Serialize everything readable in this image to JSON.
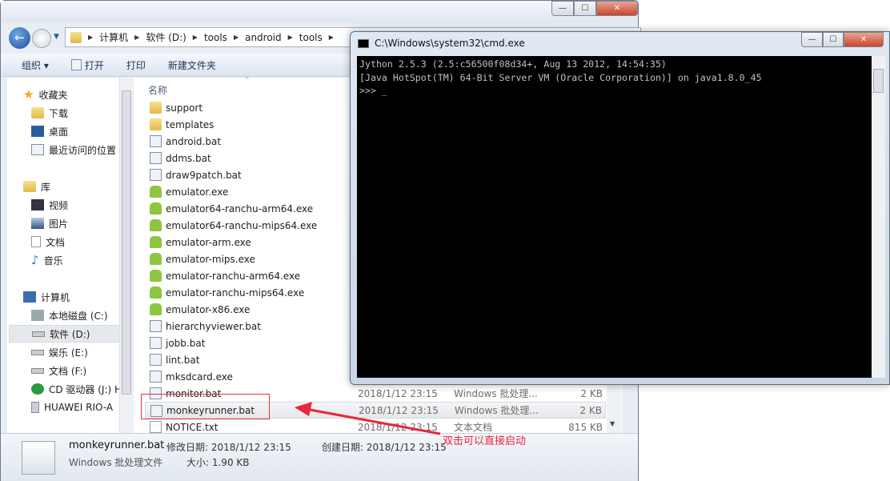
{
  "explorer": {
    "window_controls": {
      "minimize": "—",
      "maximize": "☐",
      "close": "✕"
    },
    "breadcrumb": [
      "计算机",
      "软件 (D:)",
      "tools",
      "android",
      "tools"
    ],
    "toolbar": {
      "organize": "组织 ▾",
      "open": "打开",
      "print": "打印",
      "new_folder": "新建文件夹"
    },
    "nav": {
      "favorites": {
        "label": "收藏夹",
        "items": [
          "下载",
          "桌面",
          "最近访问的位置"
        ]
      },
      "libraries": {
        "label": "库",
        "items": [
          "视频",
          "图片",
          "文档",
          "音乐"
        ]
      },
      "computer": {
        "label": "计算机",
        "items": [
          "本地磁盘 (C:)",
          "软件 (D:)",
          "娱乐 (E:)",
          "文档 (F:)",
          "CD 驱动器 (J:) H",
          "HUAWEI RIO-A"
        ]
      },
      "selected": "软件 (D:)"
    },
    "columns": {
      "name": "名称"
    },
    "files": [
      {
        "name": "support",
        "kind": "folder"
      },
      {
        "name": "templates",
        "kind": "folder"
      },
      {
        "name": "android.bat",
        "kind": "bat"
      },
      {
        "name": "ddms.bat",
        "kind": "bat"
      },
      {
        "name": "draw9patch.bat",
        "kind": "bat"
      },
      {
        "name": "emulator.exe",
        "kind": "exe"
      },
      {
        "name": "emulator64-ranchu-arm64.exe",
        "kind": "exe"
      },
      {
        "name": "emulator64-ranchu-mips64.exe",
        "kind": "exe"
      },
      {
        "name": "emulator-arm.exe",
        "kind": "exe"
      },
      {
        "name": "emulator-mips.exe",
        "kind": "exe"
      },
      {
        "name": "emulator-ranchu-arm64.exe",
        "kind": "exe"
      },
      {
        "name": "emulator-ranchu-mips64.exe",
        "kind": "exe"
      },
      {
        "name": "emulator-x86.exe",
        "kind": "exe"
      },
      {
        "name": "hierarchyviewer.bat",
        "kind": "bat"
      },
      {
        "name": "jobb.bat",
        "kind": "bat"
      },
      {
        "name": "lint.bat",
        "kind": "bat"
      },
      {
        "name": "mksdcard.exe",
        "kind": "bat"
      },
      {
        "name": "monitor.bat",
        "kind": "bat",
        "date": "2018/1/12 23:15",
        "type": "Windows 批处理...",
        "size": "2 KB"
      },
      {
        "name": "monkeyrunner.bat",
        "kind": "bat",
        "date": "2018/1/12 23:15",
        "type": "Windows 批处理...",
        "size": "2 KB",
        "selected": true
      },
      {
        "name": "NOTICE.txt",
        "kind": "txt",
        "date": "2018/1/12 23:15",
        "type": "文本文档",
        "size": "815 KB"
      }
    ],
    "details": {
      "filename": "monkeyrunner.bat",
      "modified": "修改日期: 2018/1/12 23:15",
      "created": "创建日期: 2018/1/12 23:15",
      "type": "Windows 批处理文件",
      "size": "大小: 1.90 KB"
    }
  },
  "cmd": {
    "title": "C:\\Windows\\system32\\cmd.exe",
    "lines": [
      "Jython 2.5.3 (2.5:c56500f08d34+, Aug 13 2012, 14:54:35)",
      "[Java HotSpot(TM) 64-Bit Server VM (Oracle Corporation)] on java1.8.0_45",
      ">>> _"
    ]
  },
  "annotation": {
    "text": "双击可以直接启动",
    "color": "#e8283c"
  }
}
